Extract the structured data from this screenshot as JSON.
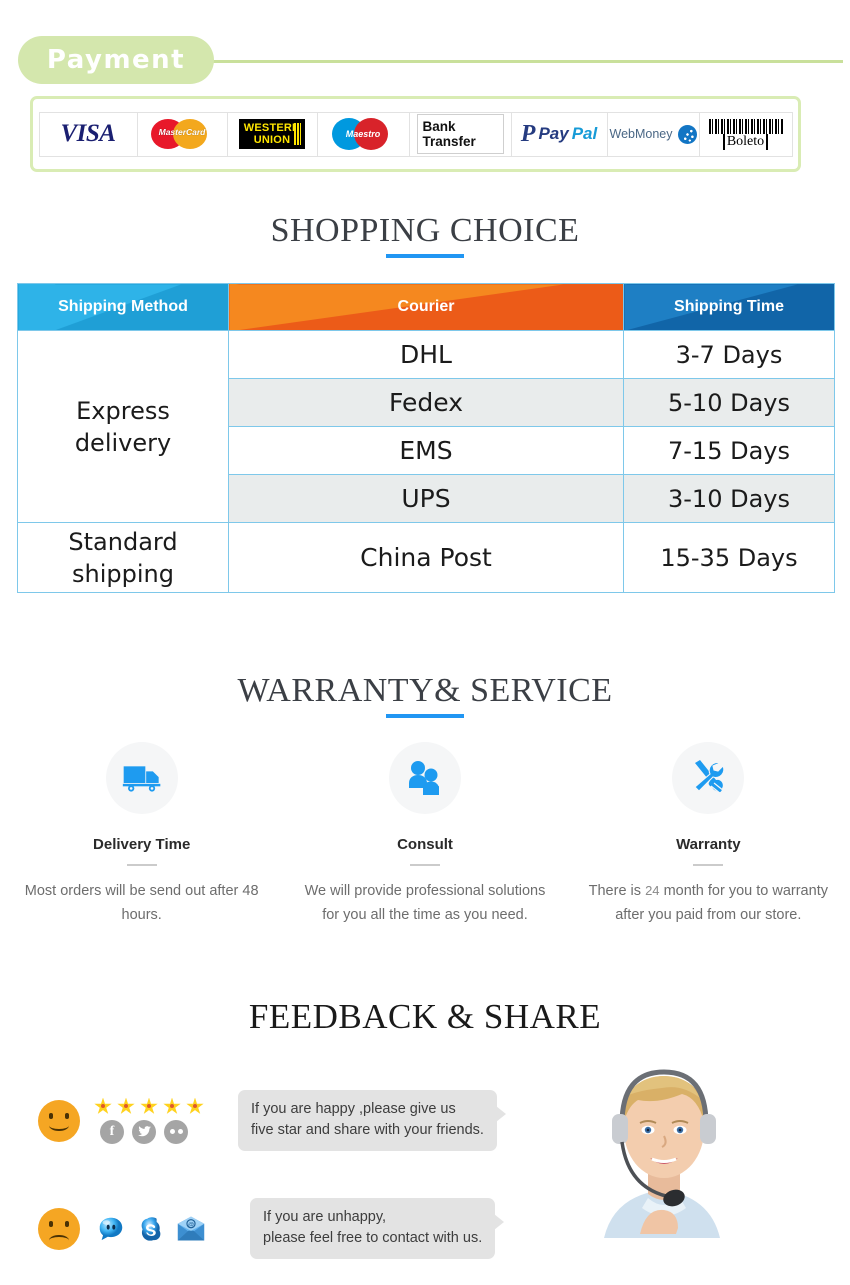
{
  "payment": {
    "badge_label": "Payment",
    "methods": [
      {
        "name": "visa",
        "label": "VISA"
      },
      {
        "name": "mastercard",
        "label": "MasterCard"
      },
      {
        "name": "western-union",
        "label_top": "WESTERN",
        "label_bottom": "UNION"
      },
      {
        "name": "maestro",
        "label": "Maestro"
      },
      {
        "name": "bank-transfer",
        "label": "Bank Transfer"
      },
      {
        "name": "paypal",
        "label_dark": "Pay",
        "label_light": "Pal"
      },
      {
        "name": "webmoney",
        "label": "WebMoney"
      },
      {
        "name": "boleto",
        "label": "Boleto"
      }
    ]
  },
  "shopping_choice": {
    "title": "SHOPPING CHOICE",
    "columns": [
      "Shipping Method",
      "Courier",
      "Shipping Time"
    ],
    "groups": [
      {
        "method": "Express\ndelivery",
        "rows": [
          {
            "courier": "DHL",
            "time": "3-7  Days"
          },
          {
            "courier": "Fedex",
            "time": "5-10 Days"
          },
          {
            "courier": "EMS",
            "time": "7-15 Days"
          },
          {
            "courier": "UPS",
            "time": "3-10 Days"
          }
        ]
      },
      {
        "method": "Standard\nshipping",
        "rows": [
          {
            "courier": "China Post",
            "time": "15-35 Days"
          }
        ]
      }
    ]
  },
  "warranty": {
    "title": "WARRANTY& SERVICE",
    "cards": [
      {
        "icon": "delivery-truck-icon",
        "heading": "Delivery Time",
        "body": "Most orders will be send out after 48 hours."
      },
      {
        "icon": "people-consult-icon",
        "heading": "Consult",
        "body": "We will provide professional solutions for you all the time as you need."
      },
      {
        "icon": "wrench-screwdriver-icon",
        "heading": "Warranty",
        "body_before": "There is",
        "body_number": "24",
        "body_after": "month for you to warranty after you paid from our store."
      }
    ]
  },
  "feedback": {
    "title": "FEEDBACK & SHARE",
    "happy": {
      "face": "smiley-happy-icon",
      "star_count": 5,
      "socials": [
        "facebook-icon",
        "twitter-icon",
        "flickr-icon"
      ],
      "message": "If you are happy ,please give us\nfive star and share with your friends."
    },
    "unhappy": {
      "face": "smiley-sad-icon",
      "icons": [
        "messenger-icon",
        "skype-icon",
        "email-icon"
      ],
      "message": "If you are unhappy,\nplease feel free to contact with us."
    }
  },
  "colors": {
    "badge_green": "#d4e7ad",
    "rule_green": "#c9e09b",
    "accent_blue": "#2196f3",
    "header_cyan": "#2eb3e8",
    "header_orange": "#f5881f",
    "header_blue": "#1e7fc4",
    "table_border": "#7ec8ea",
    "row_shade": "#e9ecec",
    "face_orange": "#f5a623",
    "star_yellow": "#ffd21e",
    "bubble_gray": "#e3e3e3"
  }
}
